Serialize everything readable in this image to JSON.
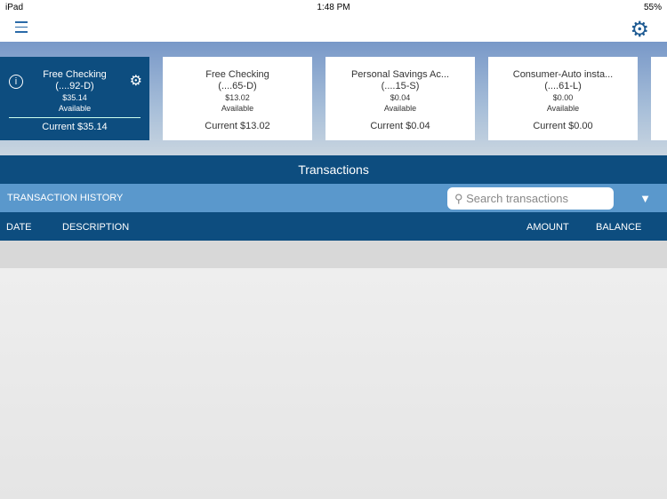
{
  "status": {
    "device": "iPad",
    "time": "1:48 PM",
    "battery": "55%"
  },
  "accounts": [
    {
      "name": "Free Checking",
      "number": "(....92-D)",
      "available": "$35.14",
      "available_label": "Available",
      "current": "Current $35.14"
    },
    {
      "name": "Free Checking",
      "number": "(....65-D)",
      "available": "$13.02",
      "available_label": "Available",
      "current": "Current $13.02"
    },
    {
      "name": "Personal Savings Ac...",
      "number": "(....15-S)",
      "available": "$0.04",
      "available_label": "Available",
      "current": "Current $0.04"
    },
    {
      "name": "Consumer-Auto insta...",
      "number": "(....61-L)",
      "available": "$0.00",
      "available_label": "Available",
      "current": "Current $0.00"
    }
  ],
  "transactions": {
    "title": "Transactions",
    "history_label": "TRANSACTION HISTORY",
    "search_placeholder": "Search transactions",
    "columns": {
      "date": "DATE",
      "description": "DESCRIPTION",
      "amount": "AMOUNT",
      "balance": "BALANCE"
    }
  }
}
